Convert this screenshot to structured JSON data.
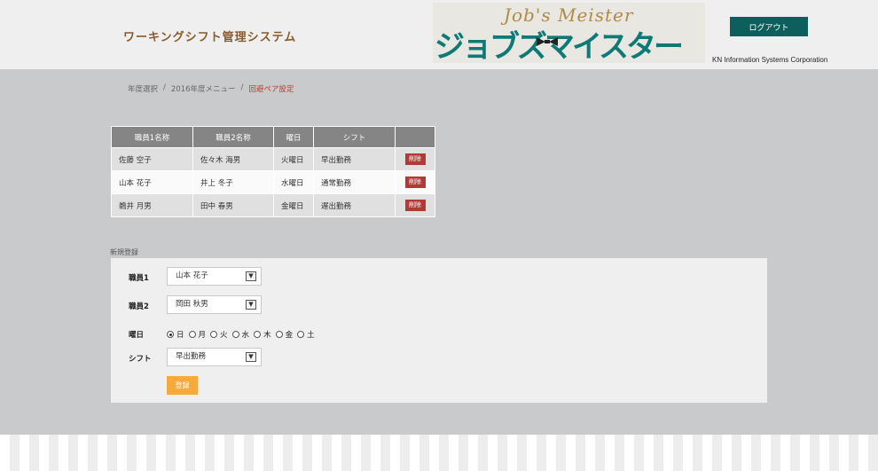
{
  "header": {
    "system_title": "ワーキングシフト管理システム",
    "logo_script": "Job's Meister",
    "logo_main": "ジョブズマイスター",
    "logout_label": "ログアウト",
    "company": "KN Information Systems Corporation"
  },
  "breadcrumb": {
    "items": [
      "年度選択",
      "2016年度メニュー",
      "回避ペア設定"
    ],
    "separator": "/"
  },
  "table": {
    "headers": [
      "職員1名称",
      "職員2名称",
      "曜日",
      "シフト",
      ""
    ],
    "rows": [
      {
        "emp1": "佐藤 空子",
        "emp2": "佐々木 海男",
        "day": "火曜日",
        "shift": "早出勤務",
        "action": "削除"
      },
      {
        "emp1": "山本 花子",
        "emp2": "井上 冬子",
        "day": "水曜日",
        "shift": "通常勤務",
        "action": "削除"
      },
      {
        "emp1": "鵜井 月男",
        "emp2": "田中 春男",
        "day": "金曜日",
        "shift": "遅出勤務",
        "action": "削除"
      }
    ]
  },
  "form": {
    "section_label": "新規登録",
    "emp1_label": "職員1",
    "emp1_value": "山本 花子",
    "emp2_label": "職員2",
    "emp2_value": "岡田 秋男",
    "day_label": "曜日",
    "days": [
      "日",
      "月",
      "火",
      "水",
      "木",
      "金",
      "土"
    ],
    "selected_day": "日",
    "shift_label": "シフト",
    "shift_value": "早出勤務",
    "submit_label": "登録"
  },
  "colors": {
    "accent": "#0d5f5e",
    "delete": "#b03a35",
    "submit": "#f7a93a",
    "breadcrumb_current": "#c0392b"
  }
}
